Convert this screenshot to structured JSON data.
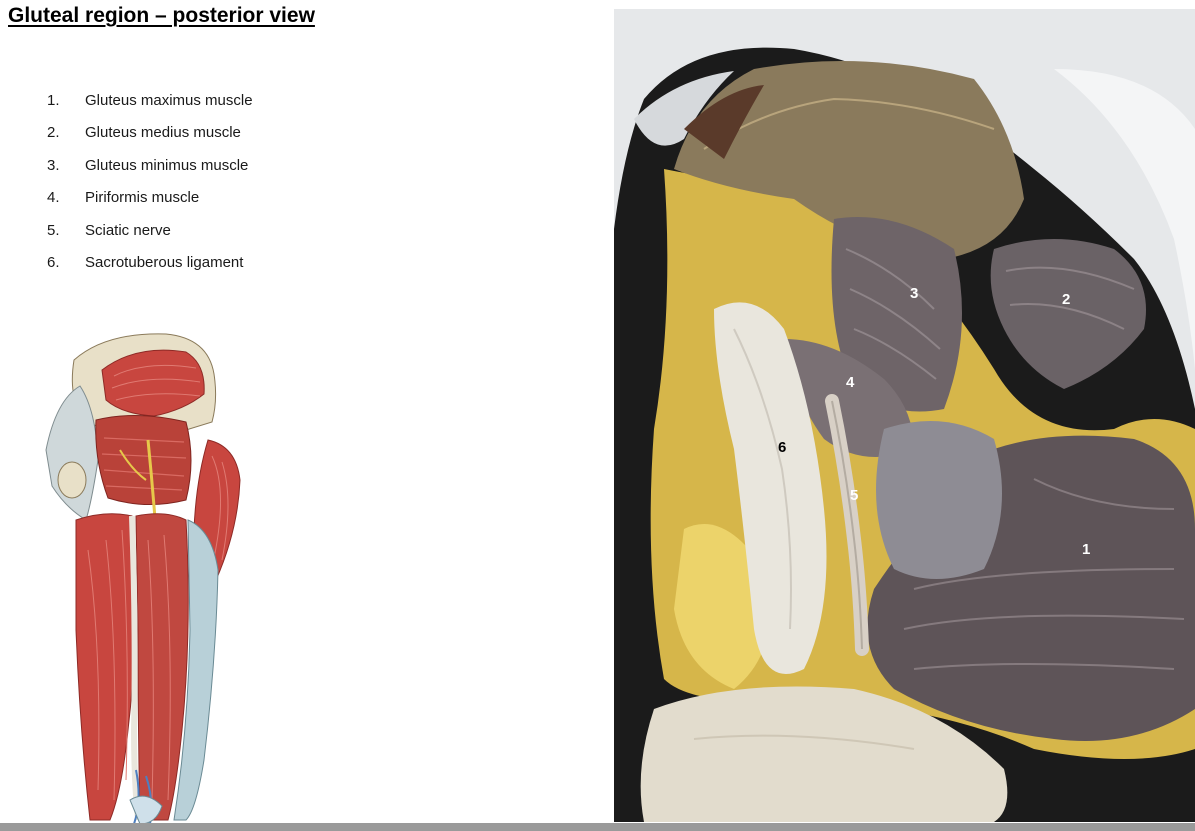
{
  "title": "Gluteal region – posterior view",
  "legend": [
    {
      "num": "1.",
      "text": "Gluteus maximus muscle"
    },
    {
      "num": "2.",
      "text": "Gluteus medius muscle"
    },
    {
      "num": "3.",
      "text": "Gluteus minimus muscle"
    },
    {
      "num": "4.",
      "text": "Piriformis muscle"
    },
    {
      "num": "5.",
      "text": "Sciatic nerve"
    },
    {
      "num": "6.",
      "text": "Sacrotuberous ligament"
    }
  ],
  "photo_labels": {
    "l1": "1",
    "l2": "2",
    "l3": "3",
    "l4": "4",
    "l5": "5",
    "l6": "6"
  },
  "colors": {
    "muscle_red": "#c8463f",
    "fat_yellow": "#e0c44a",
    "muscle_dark": "#6e6468",
    "tendon_white": "#e9e6dd",
    "footer": "#9a9a9a"
  }
}
